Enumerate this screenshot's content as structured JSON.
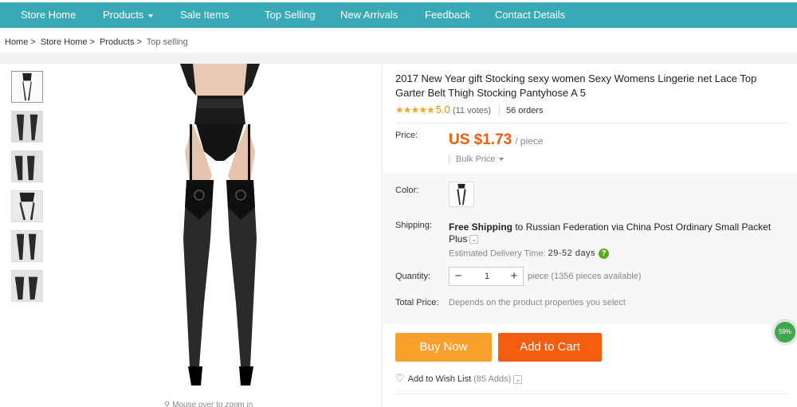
{
  "nav": {
    "items": [
      {
        "label": "Store Home"
      },
      {
        "label": "Products"
      },
      {
        "label": "Sale Items"
      },
      {
        "label": "Top Selling"
      },
      {
        "label": "New Arrivals"
      },
      {
        "label": "Feedback"
      },
      {
        "label": "Contact Details"
      }
    ]
  },
  "breadcrumb": {
    "items": [
      {
        "label": "Home",
        "sep": ">"
      },
      {
        "label": "Store Home",
        "sep": ">"
      },
      {
        "label": "Products",
        "sep": ">"
      },
      {
        "label": "Top selling"
      }
    ]
  },
  "gallery": {
    "thumb_count": 6,
    "zoom_hint": "Mouse over to zoom in"
  },
  "product": {
    "title": "2017 New Year gift Stocking sexy women Sexy Womens Lingerie net Lace Top Garter Belt Thigh Stocking Pantyhose A 5",
    "rating": {
      "stars": "★★★★★",
      "score": "5.0",
      "votes": "(11 votes)",
      "orders": "56 orders"
    },
    "price": {
      "label": "Price:",
      "amount": "US $1.73",
      "unit": "/ piece",
      "bulk": "Bulk Price"
    },
    "color_label": "Color:",
    "shipping": {
      "label": "Shipping:",
      "free": "Free Shipping",
      "to": " to Russian Federation via China Post Ordinary Small Packet Plus",
      "est_label": "Estimated Delivery Time:",
      "est_days": "29-52 days"
    },
    "quantity": {
      "label": "Quantity:",
      "value": "1",
      "minus": "−",
      "plus": "+",
      "available": "piece (1356 pieces available)"
    },
    "total": {
      "label": "Total Price:",
      "note": "Depends on the product properties you select"
    },
    "buttons": {
      "buy_now": "Buy Now",
      "add_to_cart": "Add to Cart"
    },
    "wishlist": {
      "label": "Add to Wish List",
      "count": "(85 Adds)"
    }
  },
  "widget": {
    "percent": "59%"
  },
  "colors": {
    "nav_bg": "#3aa9b6",
    "price": "#f25c0a",
    "buy_now": "#f99f2c",
    "add_to_cart": "#f35d0f",
    "stars": "#f5a623"
  },
  "icons": {
    "star": "star-icon",
    "caret": "caret-down-icon",
    "help": "question-icon",
    "heart": "heart-icon",
    "chevron": "chevron-down-icon"
  }
}
